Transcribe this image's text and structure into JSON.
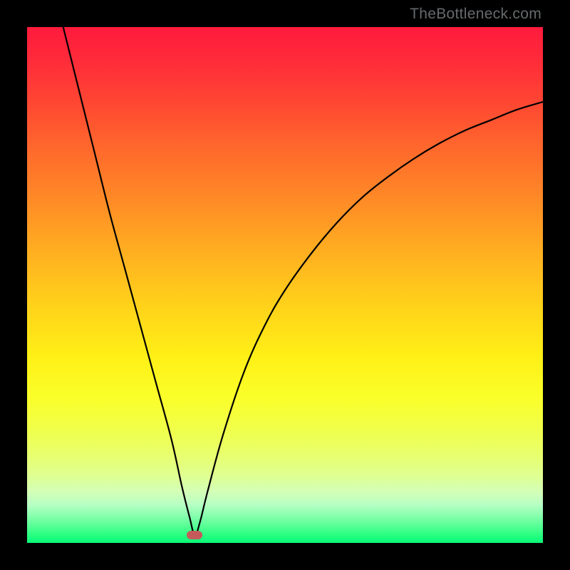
{
  "watermark": "TheBottleneck.com",
  "chart_data": {
    "type": "line",
    "title": "",
    "xlabel": "",
    "ylabel": "",
    "xlim": [
      0,
      100
    ],
    "ylim": [
      0,
      100
    ],
    "background_gradient": {
      "top": "#ff1a3c",
      "bottom": "#08f878",
      "description": "vertical gradient from red (high bottleneck) through orange, yellow to green (low bottleneck)"
    },
    "series": [
      {
        "name": "bottleneck-curve",
        "x": [
          7,
          10,
          13,
          16,
          19,
          22,
          25,
          28,
          30,
          31.5,
          32.5,
          33.5,
          35,
          38,
          42,
          46,
          50,
          55,
          60,
          65,
          70,
          75,
          80,
          85,
          90,
          95,
          100
        ],
        "y": [
          100,
          88,
          76,
          64,
          53,
          42,
          31,
          20,
          11,
          5,
          1.5,
          4,
          10,
          21,
          33,
          42,
          49,
          56,
          62,
          67,
          71,
          74.5,
          77.5,
          80,
          82,
          84,
          85.5
        ]
      }
    ],
    "marker": {
      "name": "optimal-point",
      "x": 32.5,
      "y": 1.5,
      "color": "#c55a5a"
    }
  },
  "colors": {
    "frame": "#000000",
    "curve": "#000000",
    "watermark": "#666a6c"
  }
}
